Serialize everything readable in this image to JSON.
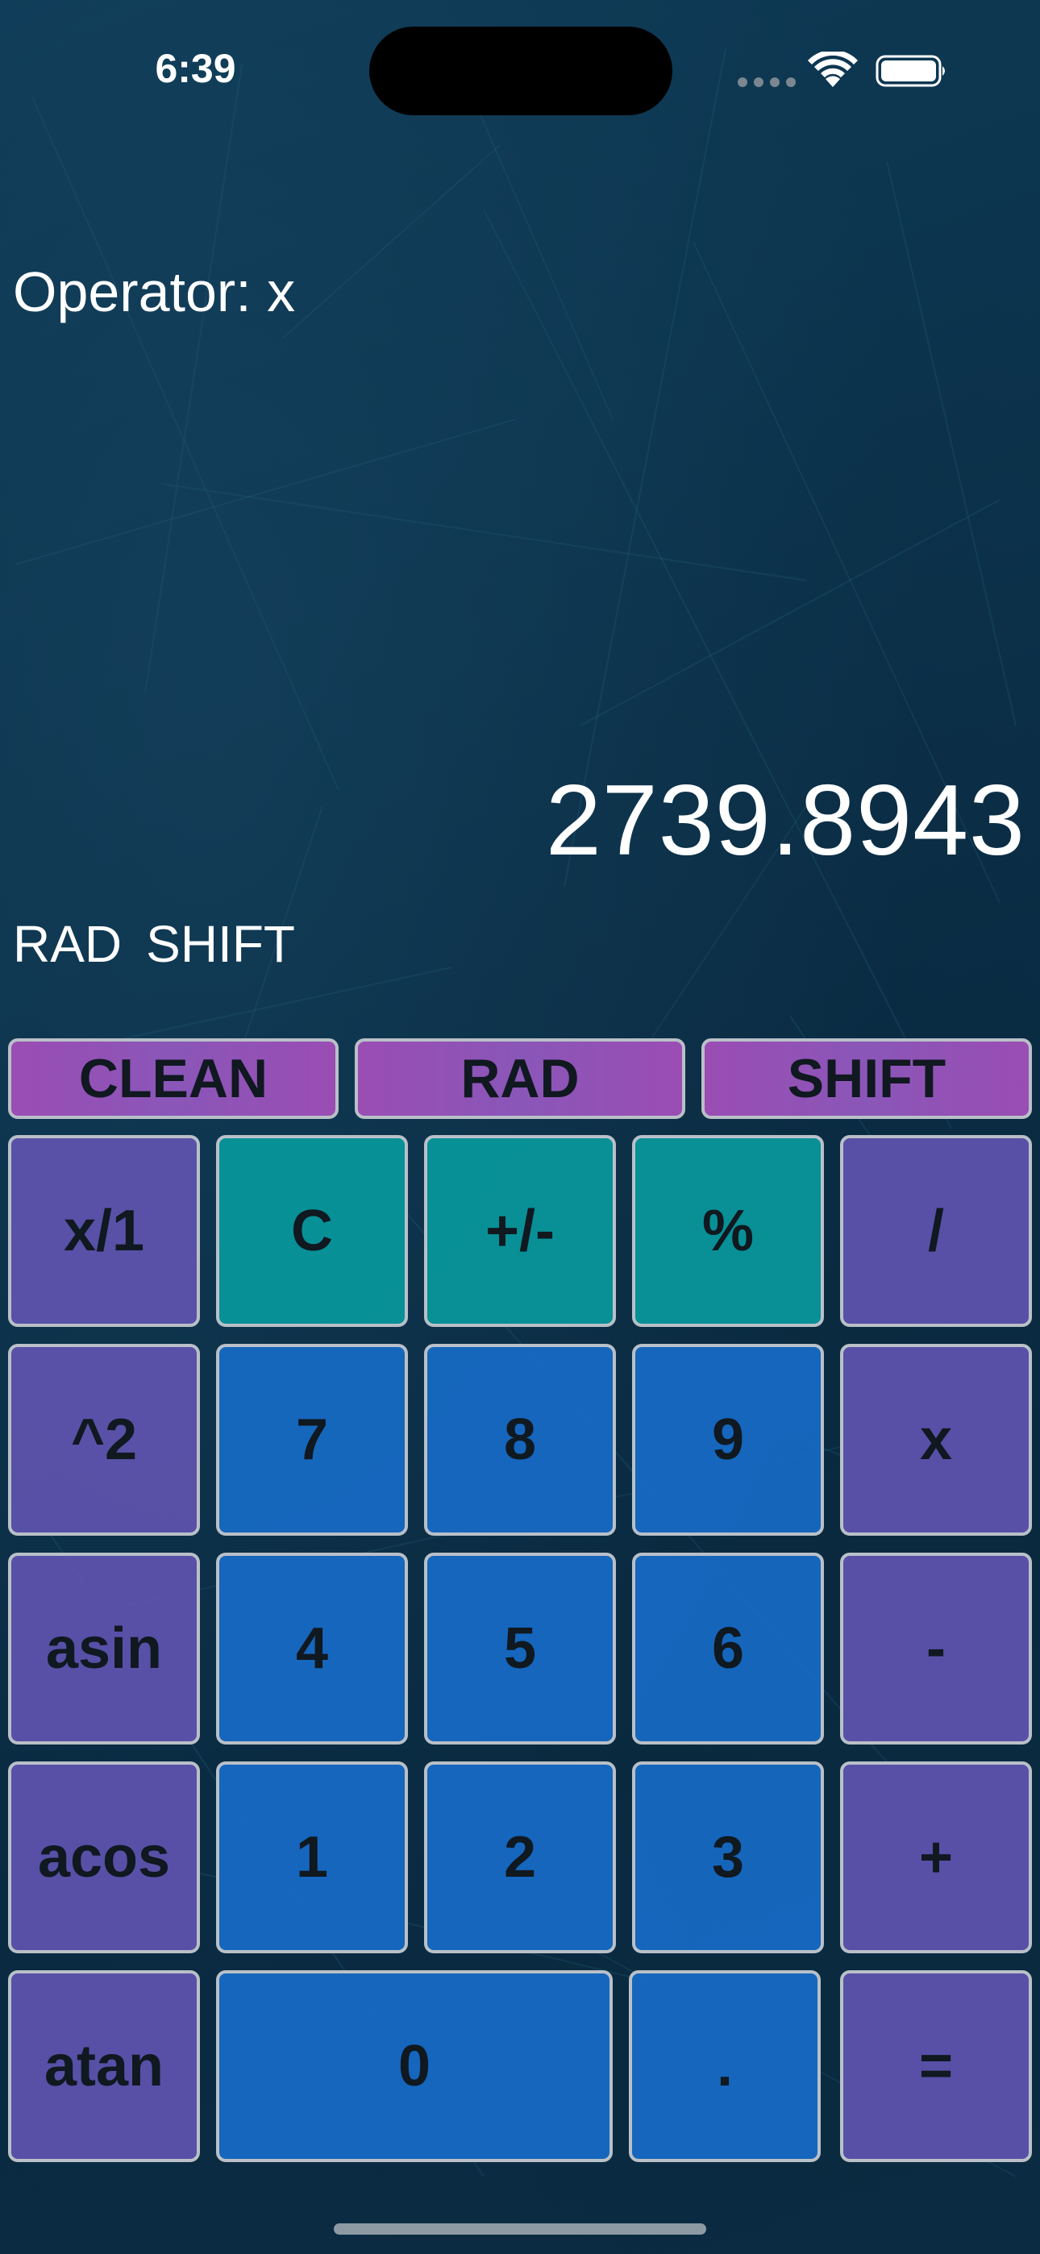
{
  "status_bar": {
    "time": "6:39"
  },
  "operator": {
    "text": "Operator: x"
  },
  "display": {
    "value": "2739.8943"
  },
  "indicators": {
    "angle_mode": "RAD",
    "shift": "SHIFT"
  },
  "top_row": {
    "clean": "CLEAN",
    "rad": "RAD",
    "shift": "SHIFT"
  },
  "keys": {
    "reciprocal": "x/1",
    "clear": "C",
    "negate": "+/-",
    "percent": "%",
    "divide": "/",
    "square": "^2",
    "seven": "7",
    "eight": "8",
    "nine": "9",
    "multiply": "x",
    "asin": "asin",
    "four": "4",
    "five": "5",
    "six": "6",
    "subtract": "-",
    "acos": "acos",
    "one": "1",
    "two": "2",
    "three": "3",
    "add": "+",
    "atan": "atan",
    "zero": "0",
    "decimal": ".",
    "equals": "="
  },
  "colors": {
    "background": "#0b3049",
    "top_buttons": "#9a4db3",
    "function_keys": "#5e54af",
    "teal_keys": "#08969b",
    "number_keys": "#166ac4",
    "key_border": "#b9c0c8"
  }
}
